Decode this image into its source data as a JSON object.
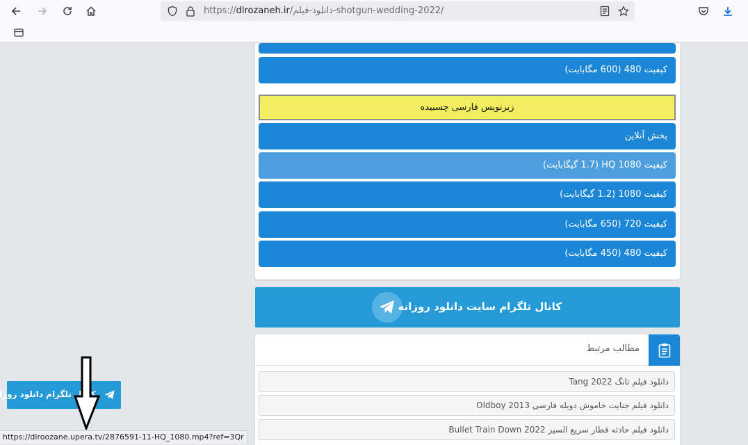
{
  "browser": {
    "url_prefix": "https://",
    "url_host": "dlrozaneh.ir",
    "url_path": "/دانلود-فیلم-shotgun-wedding-2022/",
    "status_url": "https://dlroozane.upera.tv/2876591-11-HQ_1080.mp4?ref=3Qr"
  },
  "downloads_top": [
    {
      "label": ""
    },
    {
      "label": "کیفیت 480 (600 مگابایت)"
    }
  ],
  "subtitle_banner": "زیرنویس فارسی چسبیده",
  "downloads_sub": [
    {
      "label": "پخش آنلاین"
    },
    {
      "label": "کیفیت 1080 HQ (1.7 گیگابایت)"
    },
    {
      "label": "کیفیت 1080 (1.2 گیگابایت)"
    },
    {
      "label": "کیفیت 720 (650 مگابایت)"
    },
    {
      "label": "کیفیت 480 (450 مگابایت)"
    }
  ],
  "telegram": {
    "banner_text": "کانال تلگرام سایت دانلود روزانه",
    "float_text": "کانال تلگرام دانلود روزانه"
  },
  "related": {
    "title": "مطالب مرتبط",
    "items": [
      "دانلود فیلم تانگ Tang 2022",
      "دانلود فیلم جنایت خاموش دوبله فارسی Oldboy 2013",
      "دانلود فیلم حادثه قطار سریع السیر Bullet Train Down 2022"
    ]
  },
  "colors": {
    "button_blue": "#1c86d6",
    "button_hover": "#4c9edc",
    "telegram_blue": "#269ad7",
    "subtitle_yellow": "#f2ee5f"
  },
  "icons": [
    "back-icon",
    "forward-icon",
    "reload-icon",
    "home-icon",
    "shield-icon",
    "lock-icon",
    "reader-icon",
    "star-icon",
    "pocket-icon",
    "download-icon",
    "sidebar-icon",
    "telegram-icon",
    "clipboard-icon",
    "arrow-down-icon"
  ]
}
